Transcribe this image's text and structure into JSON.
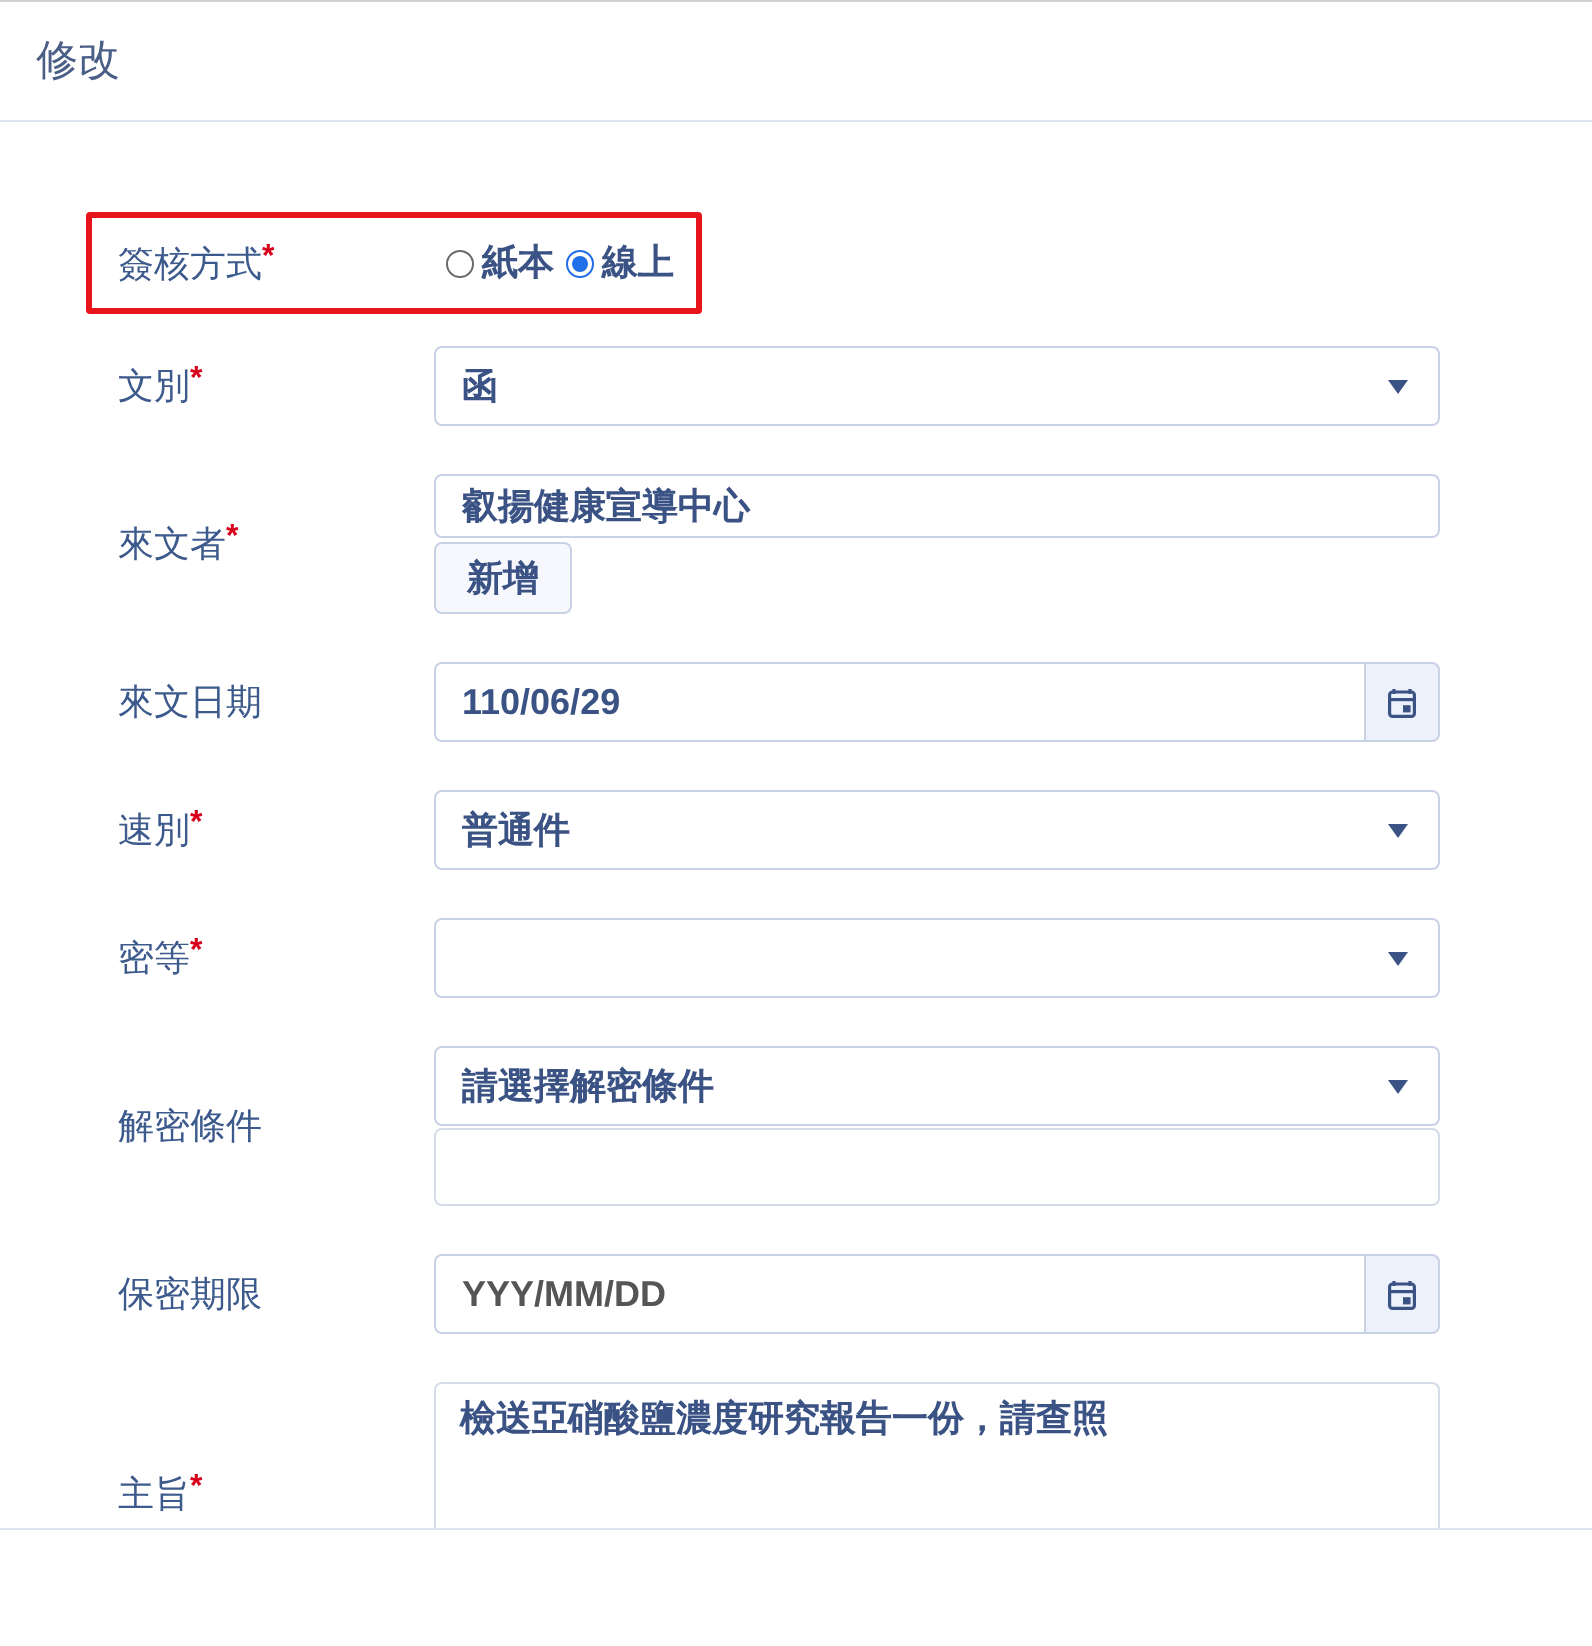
{
  "dialog": {
    "title": "修改"
  },
  "form": {
    "fields": [
      {
        "kind": "radio",
        "label": "簽核方式",
        "required_mark": "*",
        "highlighted": true,
        "options": [
          {
            "label": "紙本",
            "selected": false
          },
          {
            "label": "線上",
            "selected": true
          }
        ]
      },
      {
        "kind": "select",
        "label": "文別",
        "required_mark": "*",
        "highlighted": false,
        "value": "函"
      },
      {
        "kind": "text_with_button",
        "label": "來文者",
        "required_mark": "*",
        "highlighted": false,
        "value": "叡揚健康宣導中心",
        "button": "新增"
      },
      {
        "kind": "date",
        "label": "來文日期",
        "highlighted": false,
        "value": "110/06/29"
      },
      {
        "kind": "select",
        "label": "速別",
        "required_mark": "*",
        "highlighted": false,
        "value": "普通件"
      },
      {
        "kind": "select",
        "label": "密等",
        "required_mark": "*",
        "highlighted": false
      },
      {
        "kind": "select_with_text",
        "label": "解密條件",
        "highlighted": false,
        "value": "請選擇解密條件"
      },
      {
        "kind": "date",
        "label": "保密期限",
        "highlighted": false,
        "placeholder": "YYY/MM/DD"
      },
      {
        "kind": "textarea",
        "label": "主旨",
        "required_mark": "*",
        "highlighted": false,
        "value": "檢送亞硝酸鹽濃度研究報告一份，請查照"
      }
    ]
  }
}
